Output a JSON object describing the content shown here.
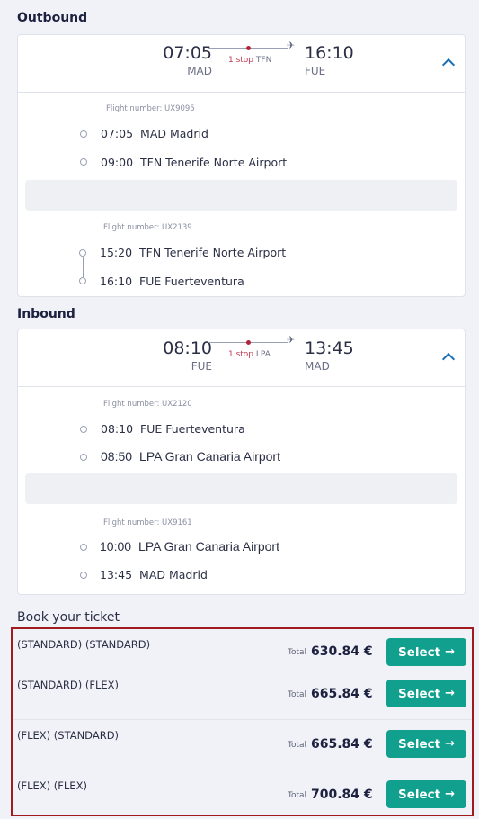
{
  "outbound": {
    "title": "Outbound",
    "depart_time": "07:05",
    "depart_code": "MAD",
    "arrive_time": "16:10",
    "arrive_code": "FUE",
    "stop_count": "1 stop",
    "stop_airport": "TFN",
    "legs": [
      {
        "flight_number": "Flight number: UX9095",
        "from_time": "07:05",
        "from_label": "MAD Madrid",
        "to_time": "09:00",
        "to_label": "TFN Tenerife Norte Airport"
      },
      {
        "flight_number": "Flight number: UX2139",
        "from_time": "15:20",
        "from_label": "TFN Tenerife Norte Airport",
        "to_time": "16:10",
        "to_label": "FUE Fuerteventura"
      }
    ]
  },
  "inbound": {
    "title": "Inbound",
    "depart_time": "08:10",
    "depart_code": "FUE",
    "arrive_time": "13:45",
    "arrive_code": "MAD",
    "stop_count": "1 stop",
    "stop_airport": "LPA",
    "legs": [
      {
        "flight_number": "Flight number: UX2120",
        "from_time": "08:10",
        "from_label": "FUE Fuerteventura",
        "to_time": "08:50",
        "to_label": "LPA Gran Canaria Airport"
      },
      {
        "flight_number": "Flight number: UX9161",
        "from_time": "10:00",
        "from_label": "LPA Gran Canaria Airport",
        "to_time": "13:45",
        "to_label": "MAD Madrid"
      }
    ]
  },
  "booking": {
    "title": "Book your ticket",
    "fares": [
      {
        "label": "(STANDARD) (STANDARD)",
        "total_label": "Total",
        "price": "630.84 €",
        "button": "Select"
      },
      {
        "label": "(STANDARD) (FLEX)",
        "total_label": "Total",
        "price": "665.84 €",
        "button": "Select"
      },
      {
        "label": "(FLEX) (STANDARD)",
        "total_label": "Total",
        "price": "665.84 €",
        "button": "Select"
      },
      {
        "label": "(FLEX) (FLEX)",
        "total_label": "Total",
        "price": "700.84 €",
        "button": "Select"
      }
    ]
  },
  "icons": {
    "plane": "plane-icon",
    "chevron": "chevron-up-icon",
    "arrow": "arrow-right-icon"
  },
  "colors": {
    "accent": "#12a08e",
    "stop": "#c33b52",
    "highlight_border": "#a01a1f",
    "chevron": "#1a6fb6"
  }
}
